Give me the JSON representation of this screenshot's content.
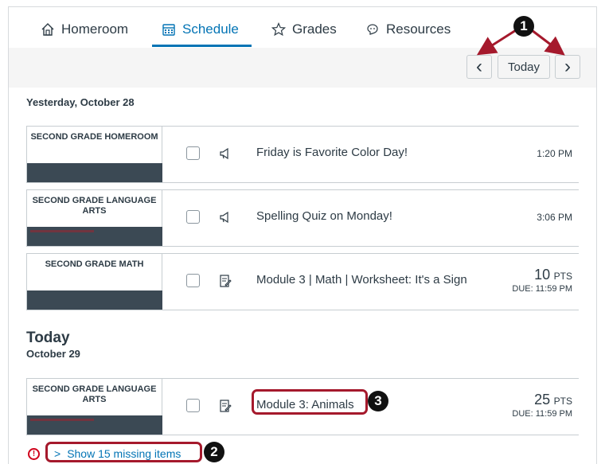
{
  "tabs": [
    {
      "label": "Homeroom",
      "icon": "home-icon"
    },
    {
      "label": "Schedule",
      "icon": "calendar-icon"
    },
    {
      "label": "Grades",
      "icon": "star-icon"
    },
    {
      "label": "Resources",
      "icon": "resources-icon"
    }
  ],
  "nav": {
    "today_label": "Today",
    "prev": "‹",
    "next": "›"
  },
  "yesterday_heading": "Yesterday, October 28",
  "today": {
    "heading": "Today",
    "subheading": "October 29"
  },
  "items": [
    {
      "course": "SECOND GRADE HOMEROOM",
      "type": "announcement",
      "title": "Friday is Favorite Color Day!",
      "time": "1:20 PM"
    },
    {
      "course": "SECOND GRADE LANGUAGE ARTS",
      "type": "announcement",
      "title": "Spelling Quiz on Monday!",
      "time": "3:06 PM"
    },
    {
      "course": "SECOND GRADE MATH",
      "type": "assignment",
      "title": "Module 3 | Math | Worksheet: It's a Sign",
      "points": "10",
      "points_unit": "PTS",
      "due": "DUE: 11:59 PM"
    },
    {
      "course": "SECOND GRADE LANGUAGE ARTS",
      "type": "assignment",
      "title": "Module 3: Animals",
      "points": "25",
      "points_unit": "PTS",
      "due": "DUE: 11:59 PM"
    }
  ],
  "missing": {
    "label": "Show 15 missing items",
    "chevron": ">"
  },
  "callouts": [
    "1",
    "2",
    "3"
  ],
  "colors": {
    "accent": "#0374b5",
    "callout_border": "#a5192c",
    "warning": "#d0021b",
    "course_stripe": "#3b4954"
  }
}
